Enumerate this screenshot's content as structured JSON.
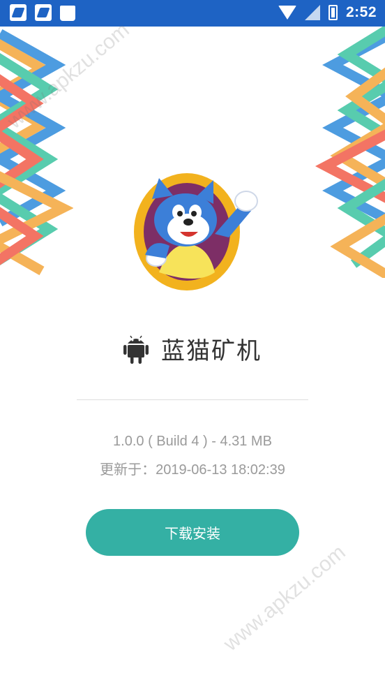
{
  "status_bar": {
    "time": "2:52",
    "background_color": "#1E63C4",
    "icons": [
      "app-notification-icon",
      "app-notification-icon",
      "shopping-bag-icon",
      "wifi-icon",
      "signal-icon",
      "battery-charging-icon"
    ]
  },
  "watermark": {
    "text": "www.apkzu.com"
  },
  "app": {
    "name": "蓝猫矿机",
    "version_line": "1.0.0 ( Build 4 ) - 4.31 MB",
    "updated_line": "更新于：2019-06-13 18:02:39",
    "logo": "blue-cat-logo-icon",
    "platform_icon": "android-icon"
  },
  "actions": {
    "install_label": "下载安装",
    "install_color": "#34B0A4"
  }
}
